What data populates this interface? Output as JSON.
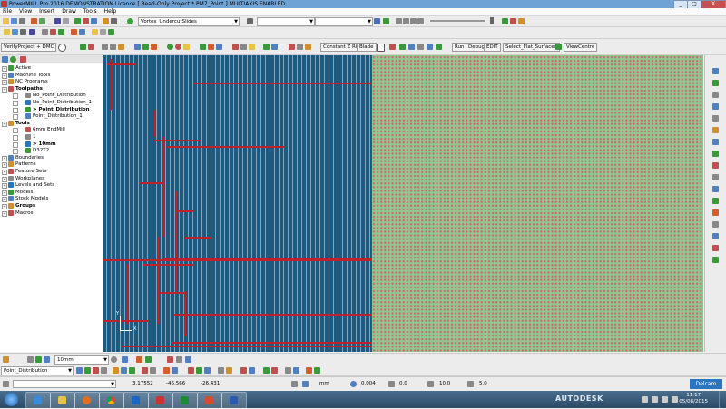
{
  "window": {
    "title": "PowerMILL Pro 2016 DEMONSTRATION Licence   [ Read-Only Project * PM7_Point ]   MULTIAXIS ENABLED",
    "min": "_",
    "max": "□",
    "close": "X"
  },
  "menu": [
    "File",
    "View",
    "Insert",
    "Draw",
    "Tools",
    "Help"
  ],
  "toolbar1": {
    "project_combo": "Vortex_UndercutSlides"
  },
  "toolbar2": {
    "verify_button": "VerifyProject + DMC",
    "constant_z_ribs": "Constant Z Ribs",
    "blade": "Blade",
    "run": "Run",
    "debug": "Debug",
    "edit": "EDIT",
    "select_flat_surfaces": "Select_Flat_Surfaces",
    "view_centre": "ViewCentre"
  },
  "explorer": {
    "items": [
      {
        "label": "Active",
        "indent": 0
      },
      {
        "label": "Machine Tools",
        "indent": 0
      },
      {
        "label": "NC Programs",
        "indent": 0
      },
      {
        "label": "Toolpaths",
        "indent": 0,
        "bold": true
      },
      {
        "label": "No_Point_Distribution",
        "indent": 2
      },
      {
        "label": "No_Point_Distribution_1",
        "indent": 2
      },
      {
        "label": "> Point_Distribution",
        "indent": 2,
        "bold": true
      },
      {
        "label": "Point_Distribution_1",
        "indent": 2
      },
      {
        "label": "Tools",
        "indent": 0,
        "bold": true
      },
      {
        "label": "6mm EndMill",
        "indent": 2
      },
      {
        "label": "1",
        "indent": 2
      },
      {
        "label": "> 10mm",
        "indent": 2,
        "bold": true
      },
      {
        "label": "D32T2",
        "indent": 2
      },
      {
        "label": "Boundaries",
        "indent": 0
      },
      {
        "label": "Patterns",
        "indent": 0
      },
      {
        "label": "Feature Sets",
        "indent": 0
      },
      {
        "label": "Workplanes",
        "indent": 0
      },
      {
        "label": "Levels and Sets",
        "indent": 0
      },
      {
        "label": "Models",
        "indent": 0
      },
      {
        "label": "Stock Models",
        "indent": 0
      },
      {
        "label": "Groups",
        "indent": 0,
        "bold": true
      },
      {
        "label": "Macros",
        "indent": 0
      }
    ]
  },
  "bottom_toolbar": {
    "tool_combo": "10mm",
    "toolpath_combo": "Point_Distribution"
  },
  "status": {
    "x": "3.17552",
    "y": "-46.566",
    "z": "-26.431",
    "units": "mm",
    "tol": "0.004",
    "angle": "0.0",
    "step": "10.0",
    "feed": "5.0",
    "brand": "Delcam"
  },
  "taskbar": {
    "autodesk": "AUTODESK",
    "time": "11:17",
    "date": "05/08/2015"
  },
  "icons": [
    "start-orb-icon",
    "ie-icon",
    "folder-icon",
    "media-icon",
    "chrome-icon",
    "outlook-icon",
    "powermill-icon",
    "excel-icon",
    "powerpoint-icon",
    "word-icon"
  ],
  "colors": {
    "toolpath_blue": "#1e5a80",
    "point_red": "#c0202a",
    "stock_green": "#8fc78f"
  }
}
